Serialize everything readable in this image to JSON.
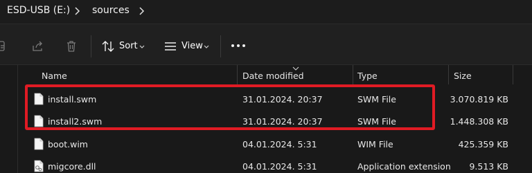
{
  "breadcrumb": {
    "drive": "ESD-USB (E:)",
    "folder": "sources"
  },
  "toolbar": {
    "sort_label": "Sort",
    "view_label": "View"
  },
  "columns": {
    "name": "Name",
    "date": "Date modified",
    "type": "Type",
    "size": "Size"
  },
  "files": [
    {
      "name": "install.swm",
      "date": "31.01.2024. 20:37",
      "type": "SWM File",
      "size": "3.070.819 KB"
    },
    {
      "name": "install2.swm",
      "date": "31.01.2024. 20:37",
      "type": "SWM File",
      "size": "1.448.308 KB"
    },
    {
      "name": "boot.wim",
      "date": "04.01.2024. 5:31",
      "type": "WIM File",
      "size": "425.359 KB"
    },
    {
      "name": "migcore.dll",
      "date": "04.01.2024. 5:31",
      "type": "Application extension",
      "size": "9.513 KB"
    }
  ],
  "colors": {
    "highlight": "#e01b24",
    "accent": "#4cc2ff"
  },
  "icons": [
    "chevron-right-icon",
    "copy-icon",
    "share-icon",
    "delete-icon",
    "sort-icon",
    "view-icon",
    "more-icon",
    "file-icon",
    "dll-file-icon"
  ]
}
